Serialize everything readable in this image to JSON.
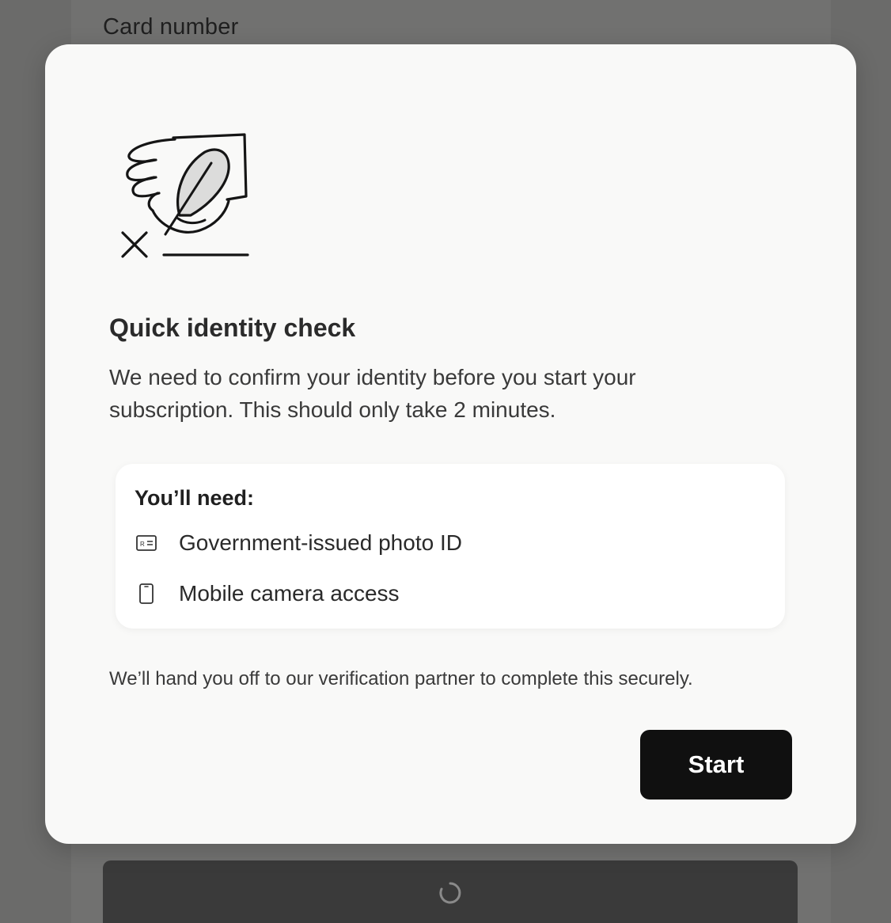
{
  "background": {
    "card_number_label": "Card number",
    "submit_button": {
      "state": "loading",
      "icon": "spinner-icon"
    }
  },
  "modal": {
    "illustration": "signing-hand-quill-icon",
    "title": "Quick identity check",
    "description": "We need to confirm your identity before you start your subscription. This should only take 2 minutes.",
    "needs": {
      "title": "You’ll need:",
      "items": [
        {
          "icon": "id-card-icon",
          "label": "Government-issued photo ID"
        },
        {
          "icon": "mobile-phone-icon",
          "label": "Mobile camera access"
        }
      ]
    },
    "footnote": "We’ll hand you off to our verification partner to complete this securely.",
    "start_label": "Start"
  },
  "colors": {
    "overlay": "#6b6b6a",
    "modal_bg": "#f9f9f8",
    "card_bg": "#ffffff",
    "button_bg": "#101010",
    "button_text": "#ffffff"
  }
}
